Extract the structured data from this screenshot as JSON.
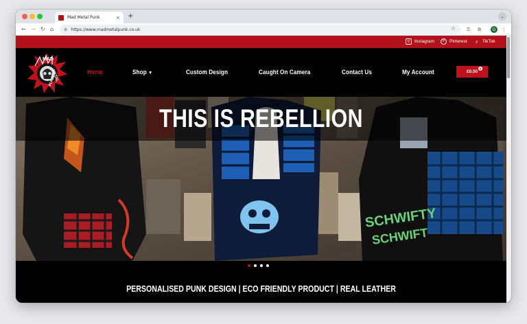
{
  "browser": {
    "tab_title": "Mad Metal Punk",
    "tab_close_icon": "×",
    "new_tab_icon": "+",
    "tab_menu_icon": "⌄",
    "url": "https://www.madmetalpunk.co.uk",
    "profile_initial": "G"
  },
  "social": {
    "instagram": "Instagram",
    "pinterest": "Pinterest",
    "tiktok": "TikTok"
  },
  "logo_text": {
    "line1": "MAD",
    "line2": "METAL",
    "line3": "PUNK"
  },
  "nav": {
    "home": "Home",
    "shop": "Shop",
    "custom_design": "Custom Design",
    "caught_on_camera": "Caught On Camera",
    "contact_us": "Contact Us",
    "my_account": "My Account"
  },
  "cart": {
    "total": "£0.00",
    "count": "0"
  },
  "hero": {
    "title": "THIS IS REBELLION",
    "slides_total": 4,
    "active_slide": 1
  },
  "tagline": "PERSONALISED PUNK DESIGN | ECO FRIENDLY PRODUCT | REAL LEATHER",
  "colors": {
    "brand_red": "#b3121b",
    "accent_red": "#c0121c",
    "background": "#000000"
  }
}
